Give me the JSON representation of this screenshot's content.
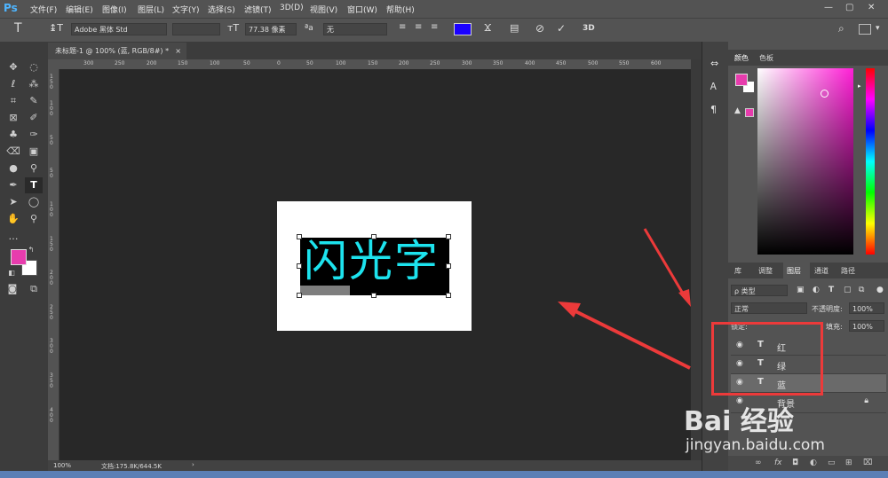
{
  "app": {
    "logo": "Ps"
  },
  "menu": [
    "文件(F)",
    "编辑(E)",
    "图像(I)",
    "图层(L)",
    "文字(Y)",
    "选择(S)",
    "滤镜(T)",
    "3D(D)",
    "视图(V)",
    "窗口(W)",
    "帮助(H)"
  ],
  "window_controls": {
    "minimize": "—",
    "restore": "▢",
    "close": "✕"
  },
  "options": {
    "font_family": "Adobe 黑体 Std",
    "font_size": "77.38 像素",
    "antialias": "无",
    "text_color": "#1a00ff",
    "mode_3d": "3D"
  },
  "document": {
    "tab_title": "未标题-1 @ 100% (蓝, RGB/8#) *",
    "canvas_text": "闪光字",
    "text_color": "#1de3ee",
    "zoom": "100%",
    "doc_size": "文档:175.8K/644.5K"
  },
  "ruler": {
    "top": [
      "300",
      "250",
      "200",
      "150",
      "100",
      "50",
      "0",
      "50",
      "100",
      "150",
      "200",
      "250",
      "300",
      "350",
      "400",
      "450",
      "500",
      "550",
      "600"
    ],
    "left": [
      "1",
      "5",
      "0",
      "1",
      "0",
      "0",
      "5",
      "0",
      "0",
      "5",
      "0",
      "1",
      "0",
      "0",
      "1",
      "5",
      "0",
      "2",
      "0",
      "0",
      "2",
      "5",
      "0",
      "3",
      "0",
      "0",
      "3",
      "5",
      "0",
      "4",
      "0",
      "0"
    ]
  },
  "color_panel": {
    "tabs": [
      "颜色",
      "色板"
    ],
    "foreground": "#e73cad",
    "background": "#ffffff"
  },
  "layers_panel": {
    "tabs": [
      "库",
      "调整",
      "图层",
      "通道",
      "路径"
    ],
    "filter_label": "ρ 类型",
    "blend_mode": "正常",
    "opacity_label": "不透明度:",
    "opacity_value": "100%",
    "lock_label": "锁定:",
    "fill_label": "填充:",
    "fill_value": "100%",
    "layers": [
      {
        "type": "T",
        "name": "红"
      },
      {
        "type": "T",
        "name": "绿"
      },
      {
        "type": "T",
        "name": "蓝"
      },
      {
        "type": "",
        "name": "背景"
      }
    ]
  },
  "watermark": {
    "line1": "Bai 经验",
    "line2": "jingyan.baidu.com"
  }
}
